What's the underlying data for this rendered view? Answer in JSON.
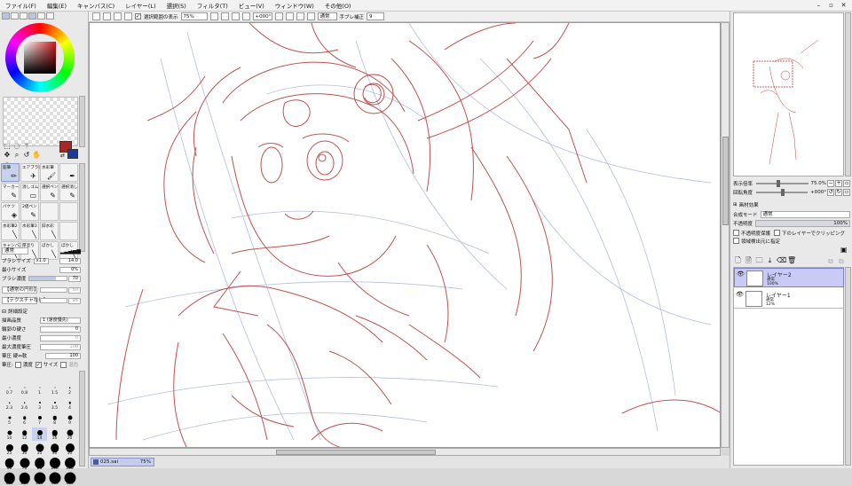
{
  "menu": [
    "ファイル(F)",
    "編集(E)",
    "キャンバス(C)",
    "レイヤー(L)",
    "選択(S)",
    "フィルタ(T)",
    "ビュー(V)",
    "ウィンドウ(W)",
    "その他(O)"
  ],
  "toolbar": {
    "selection_source_label": "選択範囲の表示",
    "zoom": "75%",
    "rotation": "+000°",
    "blend_mode": "通常",
    "stabilizer_label": "手ブレ補正",
    "stabilizer_value": "9"
  },
  "brush_tools": [
    {
      "label": "鉛筆",
      "icon": "✏"
    },
    {
      "label": "エアブラシ",
      "icon": "✈"
    },
    {
      "label": "水彩筆",
      "icon": "🖌"
    },
    {
      "label": "",
      "icon": "✒"
    },
    {
      "label": "マーカー",
      "icon": "✎"
    },
    {
      "label": "消しゴム",
      "icon": "▭"
    },
    {
      "label": "選択ペン",
      "icon": "✎"
    },
    {
      "label": "選択消し",
      "icon": "✎"
    },
    {
      "label": "バケツ",
      "icon": "◈"
    },
    {
      "label": "2値ペン",
      "icon": "✎"
    },
    {
      "label": "",
      "icon": ""
    },
    {
      "label": "",
      "icon": ""
    },
    {
      "label": "水彩筆2",
      "icon": "╲"
    },
    {
      "label": "水彩筆3",
      "icon": "╲"
    },
    {
      "label": "旧水彩",
      "icon": "╲"
    },
    {
      "label": "",
      "icon": ""
    },
    {
      "label": "キャンバス",
      "icon": "╲"
    },
    {
      "label": "厚塗り",
      "icon": "╲"
    },
    {
      "label": "ぼかし",
      "icon": "╲"
    },
    {
      "label": "ぼかし",
      "icon": "╲"
    }
  ],
  "brush_settings": {
    "mode": "通常",
    "size_label": "ブラシサイズ",
    "size_mult": "x1.0",
    "size_value": "14.0",
    "min_size_label": "最小サイズ",
    "min_size_value": "0%",
    "density_label": "ブラシ濃度",
    "density_value": "70",
    "density_fraction": 0.7,
    "shape_label": "【通常の円形】",
    "shape_value": "50",
    "texture_label": "【テクスチャなし】",
    "texture_value": "95",
    "advanced_label": "詳細設定",
    "quality_label": "描画品質",
    "quality_value": "1 (速度優先)",
    "edge_label": "輪郭の硬さ",
    "edge_value": "0",
    "min_density_label": "最小濃度",
    "min_density_value": "0",
    "max_density_label": "最大濃度筆圧",
    "max_density_value": "100",
    "pressure_label": "筆圧 硬⇔軟",
    "pressure_value": "100",
    "pressure2_label": "筆圧:",
    "opt_density": "濃度",
    "opt_size": "サイズ",
    "opt_blend": "混色"
  },
  "brush_sizes": [
    {
      "label": "0.7",
      "d": 1,
      "on": false
    },
    {
      "label": "0.8",
      "d": 1,
      "on": false
    },
    {
      "label": "1",
      "d": 1,
      "on": false
    },
    {
      "label": "1.5",
      "d": 1,
      "on": false
    },
    {
      "label": "2",
      "d": 1.5,
      "on": false
    },
    {
      "label": "2.3",
      "d": 1.5,
      "on": false
    },
    {
      "label": "2.6",
      "d": 1.5,
      "on": false
    },
    {
      "label": "3",
      "d": 2,
      "on": false
    },
    {
      "label": "3.5",
      "d": 2,
      "on": false
    },
    {
      "label": "4",
      "d": 2.5,
      "on": false
    },
    {
      "label": "5",
      "d": 3,
      "on": false
    },
    {
      "label": "6",
      "d": 3.5,
      "on": false
    },
    {
      "label": "7",
      "d": 4,
      "on": false
    },
    {
      "label": "8",
      "d": 4.5,
      "on": false
    },
    {
      "label": "9",
      "d": 5,
      "on": false
    },
    {
      "label": "10",
      "d": 5,
      "on": false
    },
    {
      "label": "12",
      "d": 5.5,
      "on": false
    },
    {
      "label": "14",
      "d": 6,
      "on": true
    },
    {
      "label": "16",
      "d": 6.5,
      "on": false
    },
    {
      "label": "20",
      "d": 7,
      "on": false
    },
    {
      "label": "25",
      "d": 8,
      "on": false
    },
    {
      "label": "30",
      "d": 8.5,
      "on": false
    },
    {
      "label": "35",
      "d": 9,
      "on": false
    },
    {
      "label": "40",
      "d": 9.5,
      "on": false
    },
    {
      "label": "50",
      "d": 10,
      "on": false
    },
    {
      "label": "60",
      "d": 10.5,
      "on": false
    },
    {
      "label": "70",
      "d": 11,
      "on": false
    },
    {
      "label": "80",
      "d": 11.5,
      "on": false
    },
    {
      "label": "100",
      "d": 12,
      "on": false
    },
    {
      "label": "120",
      "d": 12,
      "on": false
    },
    {
      "label": "160",
      "d": 12.5,
      "on": false
    },
    {
      "label": "200",
      "d": 12.5,
      "on": false
    },
    {
      "label": "250",
      "d": 13,
      "on": false
    },
    {
      "label": "300",
      "d": 13,
      "on": false
    },
    {
      "label": "350",
      "d": 13,
      "on": false
    }
  ],
  "status": {
    "filename": "025.sai",
    "zoom": "75%"
  },
  "navigator": {
    "zoom_label": "表示倍率",
    "zoom_value": "75.0%",
    "rotate_label": "回転角度",
    "rotate_value": "+000°"
  },
  "paper": {
    "title": "画材効果"
  },
  "layer_panel": {
    "blend_label": "合成モード",
    "blend_value": "通常",
    "opacity_label": "不透明度",
    "opacity_value": "100%",
    "protect_label": "不透明度保護",
    "clip_label": "下のレイヤーでクリッピング",
    "source_label": "領域検出元に指定"
  },
  "layers": [
    {
      "name": "レイヤー2",
      "mode": "通常",
      "opacity": "100%",
      "selected": true
    },
    {
      "name": "レイヤー1",
      "mode": "通常",
      "opacity": "12%",
      "selected": false
    }
  ],
  "colors": {
    "foreground": "#a82828",
    "background": "#1a3aa0",
    "sketch_red": "#b84040",
    "sketch_blue": "#a8b4d4"
  }
}
